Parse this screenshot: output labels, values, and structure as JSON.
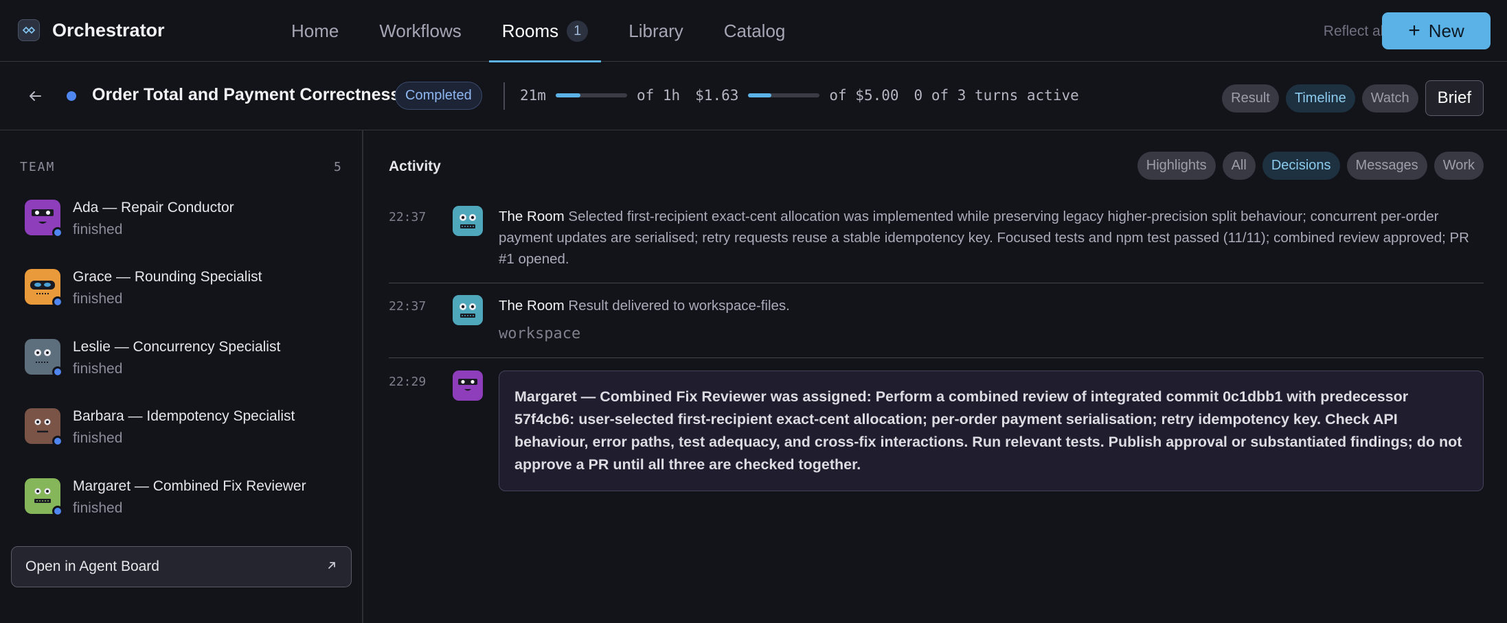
{
  "app": {
    "name": "Orchestrator",
    "logo_icon": "orchestrator-logo-icon"
  },
  "nav": {
    "tabs": [
      {
        "label": "Home"
      },
      {
        "label": "Workflows"
      },
      {
        "label": "Rooms",
        "badge": "1",
        "active": true
      },
      {
        "label": "Library"
      },
      {
        "label": "Catalog"
      }
    ],
    "reflect_all": "Reflect all",
    "new_button": {
      "icon": "+",
      "label": "New"
    }
  },
  "room": {
    "title": "Order Total and Payment Correctness",
    "status": "Completed",
    "time_used": "21m",
    "time_limit": "of 1h",
    "time_progress": 0.35,
    "cost_used": "$1.63",
    "cost_limit": "of $5.00",
    "cost_progress": 0.326,
    "turns": "0 of 3 turns active",
    "view_pills": [
      {
        "label": "Result",
        "selected": false
      },
      {
        "label": "Timeline",
        "selected": true
      },
      {
        "label": "Watch",
        "selected": false
      }
    ],
    "brief_button": "Brief"
  },
  "team": {
    "heading": "TEAM",
    "count": "5",
    "members": [
      {
        "name": "Ada — Repair Conductor",
        "status": "finished",
        "color": "#8e3dbb"
      },
      {
        "name": "Grace — Rounding Specialist",
        "status": "finished",
        "color": "#e99a3a"
      },
      {
        "name": "Leslie — Concurrency Specialist",
        "status": "finished",
        "color": "#5d6f7c"
      },
      {
        "name": "Barbara — Idempotency Specialist",
        "status": "finished",
        "color": "#7a5446"
      },
      {
        "name": "Margaret — Combined Fix Reviewer",
        "status": "finished",
        "color": "#86b65a"
      }
    ],
    "agent_board": "Open in Agent Board"
  },
  "activity": {
    "title": "Activity",
    "filters": [
      {
        "label": "Highlights",
        "selected": false
      },
      {
        "label": "All",
        "selected": false
      },
      {
        "label": "Decisions",
        "selected": true
      },
      {
        "label": "Messages",
        "selected": false
      },
      {
        "label": "Work",
        "selected": false
      }
    ],
    "entries": [
      {
        "time": "22:37",
        "who": "The Room",
        "text": "Selected first-recipient exact-cent allocation was implemented while preserving legacy higher-precision split behaviour; concurrent per-order payment updates are serialised; retry requests reuse a stable idempotency key. Focused tests and npm test passed (11/11); combined review approved; PR #1 opened."
      },
      {
        "time": "22:37",
        "who": "The Room",
        "text": "Result delivered to workspace-files.",
        "file": "workspace"
      },
      {
        "time": "22:29",
        "text": "Margaret — Combined Fix Reviewer was assigned: Perform a combined review of integrated commit 0c1dbb1 with predecessor 57f4cb6: user-selected first-recipient exact-cent allocation; per-order payment serialisation; retry idempotency key. Check API behaviour, error paths, test adequacy, and cross-fix interactions. Run relevant tests. Publish approval or substantiated findings; do not approve a PR until all three are checked together."
      }
    ]
  },
  "colors": {
    "accent": "#5bb2e6",
    "status_dot": "#4f86f0",
    "room_avatar": "#4fa7bb"
  }
}
